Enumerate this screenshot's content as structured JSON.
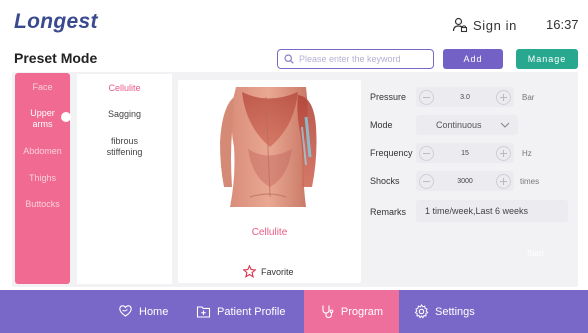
{
  "header": {
    "logo": "Longest",
    "signin_label": "Sign in",
    "time": "16:37"
  },
  "page_title": "Preset Mode",
  "search": {
    "placeholder": "Please enter the keyword",
    "value": ""
  },
  "buttons": {
    "add": "Add",
    "manage": "Manage",
    "start": "Start"
  },
  "categories": [
    {
      "label": "Face",
      "active": false
    },
    {
      "label": "Upper arms",
      "active": true
    },
    {
      "label": "Abdomen",
      "active": false
    },
    {
      "label": "Thighs",
      "active": false
    },
    {
      "label": "Buttocks",
      "active": false
    }
  ],
  "subcategories": [
    {
      "label": "Cellulite",
      "active": true
    },
    {
      "label": "Sagging",
      "active": false
    },
    {
      "label": "fibrous stiffening",
      "active": false
    }
  ],
  "image_title": "Cellulite",
  "favorite_label": "Favorite",
  "params": {
    "pressure": {
      "label": "Pressure",
      "value": "3.0",
      "unit": "Bar"
    },
    "mode": {
      "label": "Mode",
      "value": "Continuous"
    },
    "frequency": {
      "label": "Frequency",
      "value": "15",
      "unit": "Hz"
    },
    "shocks": {
      "label": "Shocks",
      "value": "3000",
      "unit": "times"
    },
    "remarks": {
      "label": "Remarks",
      "value": "1 time/week,Last 6 weeks"
    }
  },
  "nav": {
    "home": "Home",
    "patient_profile": "Patient Profile",
    "program": "Program",
    "settings": "Settings"
  },
  "colors": {
    "brand": "#3a4a8f",
    "accent_purple": "#7a68c8",
    "accent_pink": "#f06a92",
    "accent_green": "#28a88f"
  },
  "icons": {
    "signin": "user-lock-icon",
    "search": "search-icon",
    "favorite": "star-outline-icon",
    "home": "heart-hand-icon",
    "patient_profile": "patient-folder-icon",
    "program": "stethoscope-icon",
    "settings": "gear-icon"
  }
}
